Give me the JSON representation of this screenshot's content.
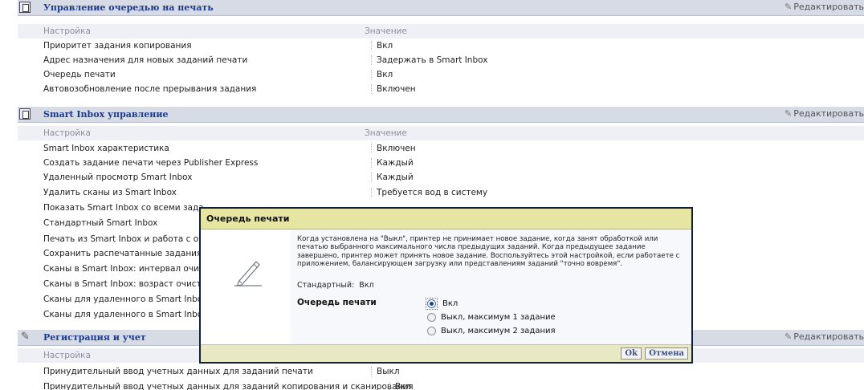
{
  "edit_label": "Редактировать",
  "columns": {
    "setting": "Настройка",
    "value": "Значение"
  },
  "sections": {
    "queue": {
      "title": "Управление очередью на печать",
      "rows": [
        {
          "key": "Приоритет задания копирования",
          "value": "Вкл"
        },
        {
          "key": "Адрес назначения для новых заданий печати",
          "value": "Задержать в Smart Inbox"
        },
        {
          "key": "Очередь печати",
          "value": "Вкл"
        },
        {
          "key": "Автовозобновление после прерывания задания",
          "value": "Включен"
        }
      ]
    },
    "inbox": {
      "title": "Smart Inbox управление",
      "rows": [
        {
          "key": "Smart Inbox характеристика",
          "value": "Включен"
        },
        {
          "key": "Создать задание печати через Publisher Express",
          "value": "Каждый"
        },
        {
          "key": "Удаленный просмотр Smart Inbox",
          "value": "Каждый"
        },
        {
          "key": "Удалить сканы из Smart Inbox",
          "value": "Требуется вод в систему"
        },
        {
          "key": "Показать Smart Inbox со всеми зада",
          "value": ""
        },
        {
          "key": "Стандартный Smart Inbox",
          "value": ""
        },
        {
          "key": "Печать из Smart Inbox и работа с оч",
          "value": ""
        },
        {
          "key": "Сохранить распечатанные задания",
          "value": ""
        },
        {
          "key": "Сканы в Smart Inbox: интервал очис",
          "value": ""
        },
        {
          "key": "Сканы в Smart Inbox: возраст очист",
          "value": ""
        },
        {
          "key": "Сканы для удаленного в Smart Inbox",
          "value": ""
        },
        {
          "key": "Сканы для удаленного в Smart Inbox",
          "value": ""
        }
      ]
    },
    "registration": {
      "title": "Регистрация и учет",
      "rows": [
        {
          "key": "Принудительный ввод учетных данных для заданий печати",
          "value": "Выкл"
        },
        {
          "key": "Принудительный ввод учетных данных для заданий копирования и сканирования",
          "value": "Вкл"
        }
      ]
    }
  },
  "dialog": {
    "title": "Очередь печати",
    "description": "Когда установлена на \"Выкл\", принтер не принимает новое задание, когда занят обработкой или печатью выбранного максимального числа предыдущих заданий. Когда предыдущее задание завершено, принтер может принять новое задание. Воспользуйтесь этой настройкой, если работаете с приложением, балансирующем загрузку или представлениям заданий \"точно вовремя\".",
    "default_label": "Стандартный:",
    "default_value": "Вкл",
    "field_label": "Очередь печати",
    "options": [
      "Вкл",
      "Выкл, максимум 1 задание",
      "Выкл, максимум 2 задания"
    ],
    "selected": "Вкл",
    "ok": "Ok",
    "cancel": "Отмена"
  },
  "colors": {
    "section_header_bg": "#d6dbe6",
    "section_title": "#1b3a8c",
    "dialog_title_bg": "#e6e5a2",
    "dialog_border": "#10203c"
  }
}
